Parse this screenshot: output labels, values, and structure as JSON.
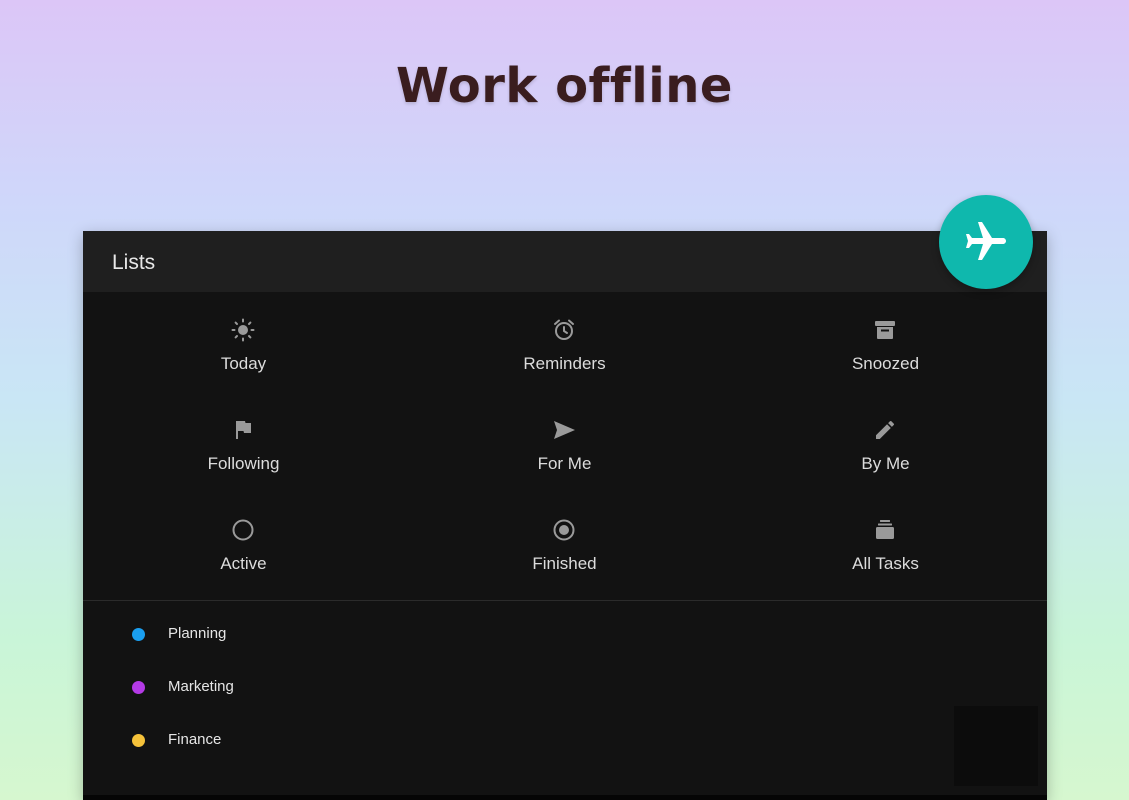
{
  "headline": "Work offline",
  "panel": {
    "title": "Lists"
  },
  "quick_lists": [
    {
      "label": "Today",
      "icon": "sun-icon"
    },
    {
      "label": "Reminders",
      "icon": "alarm-clock-icon"
    },
    {
      "label": "Snoozed",
      "icon": "archive-box-icon"
    },
    {
      "label": "Following",
      "icon": "flag-icon"
    },
    {
      "label": "For Me",
      "icon": "send-arrow-icon"
    },
    {
      "label": "By Me",
      "icon": "pencil-icon"
    },
    {
      "label": "Active",
      "icon": "circle-outline-icon"
    },
    {
      "label": "Finished",
      "icon": "radio-checked-icon"
    },
    {
      "label": "All Tasks",
      "icon": "stack-icon"
    }
  ],
  "categories": [
    {
      "name": "Planning",
      "color": "#1a9ff0"
    },
    {
      "name": "Marketing",
      "color": "#b43ae6"
    },
    {
      "name": "Finance",
      "color": "#f5c23a"
    }
  ],
  "fab": {
    "icon": "airplane-icon",
    "color": "#0fb8ad"
  },
  "colors": {
    "panel_bg": "#121212",
    "header_bg": "#1f1f1f",
    "icon_gray": "#9a9a9a",
    "headline_text": "#3a1d1f"
  }
}
